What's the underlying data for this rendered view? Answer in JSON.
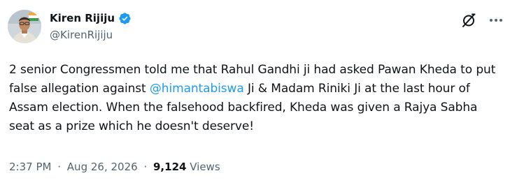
{
  "author": {
    "display_name": "Kiren Rijiju",
    "handle": "@KirenRijiju",
    "verified": true,
    "verified_color": "#1d9bf0"
  },
  "tweet": {
    "text_part1": "2 senior Congressmen told me that Rahul Gandhi ji had asked Pawan Kheda to put false allegation against ",
    "mention": "@himantabiswa",
    "text_part2": " Ji & Madam Riniki Ji at the last hour of Assam election. When the falsehood backfired, Kheda was given a Rajya Sabha seat as a prize which he doesn't deserve!",
    "mention_color": "#1d9bf0"
  },
  "meta": {
    "time": "2:37 PM",
    "separator": "·",
    "date": "Aug 26, 2026",
    "views_count": "9,124",
    "views_label": "Views"
  },
  "icons": {
    "grok": "grok-icon",
    "more": "more-icon",
    "verified": "verified-badge-icon"
  }
}
